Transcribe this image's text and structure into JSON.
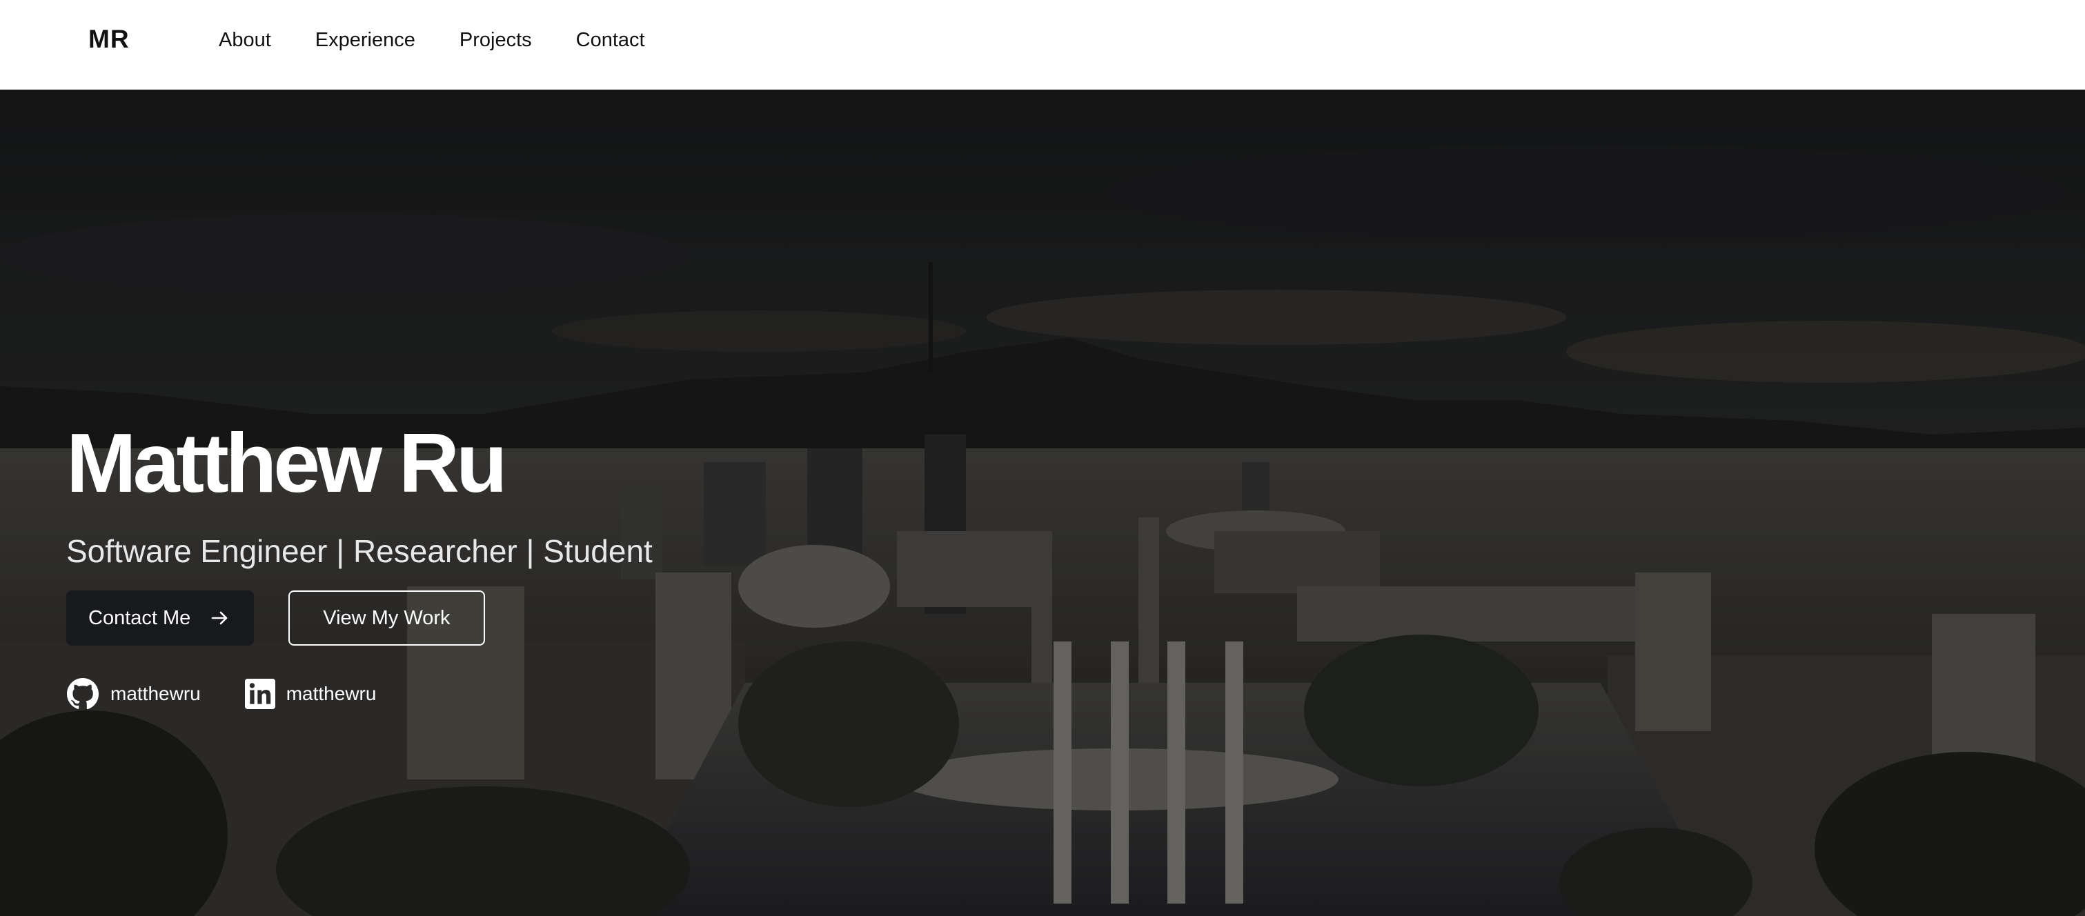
{
  "navbar": {
    "brand": "MR",
    "links": [
      {
        "label": "About"
      },
      {
        "label": "Experience"
      },
      {
        "label": "Projects"
      },
      {
        "label": "Contact"
      }
    ]
  },
  "hero": {
    "name": "Matthew Ru",
    "subtitle": "Software Engineer | Researcher | Student",
    "primary_button": {
      "label": "Contact Me",
      "icon": "arrow-right-icon"
    },
    "secondary_button": {
      "label": "View My Work"
    },
    "socials": [
      {
        "icon": "github-icon",
        "label": "matthewru"
      },
      {
        "icon": "linkedin-icon",
        "label": "matthewru"
      }
    ],
    "background": "cityscape-photo"
  },
  "colors": {
    "navbar_bg": "#ffffff",
    "text_dark": "#111111",
    "primary_button_bg": "#17191d",
    "hero_text": "#ffffff"
  }
}
